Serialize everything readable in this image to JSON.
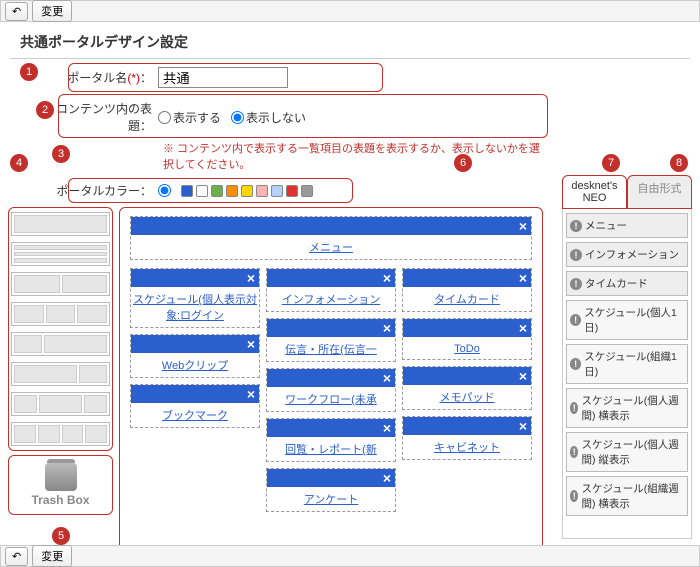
{
  "toolbar": {
    "back": "↶",
    "change": "変更"
  },
  "title": "共通ポータルデザイン設定",
  "form": {
    "name_label": "ポータル名",
    "req": "(*)",
    "colon": "：",
    "name_value": "共通",
    "content_title_label": "コンテンツ内の表題：",
    "radio_show": "表示する",
    "radio_hide": "表示しない",
    "note": "※ コンテンツ内で表示する一覧項目の表題を表示するか、表示しないかを選択してください。",
    "color_label": "ポータルカラー：",
    "colors": [
      "#2b5fce",
      "#ffffff",
      "#6ab04c",
      "#ff8c00",
      "#ffd700",
      "#ffb3b3",
      "#b3d1ff",
      "#d33",
      "#999999"
    ]
  },
  "badges": [
    "1",
    "2",
    "3",
    "4",
    "5",
    "6",
    "7",
    "8"
  ],
  "trash": "Trash Box",
  "canvas": {
    "top": "メニュー",
    "col1": [
      {
        "t": "スケジュール(個人表示対象:ログイン"
      },
      {
        "t": "Webクリップ"
      },
      {
        "t": "ブックマーク"
      }
    ],
    "col2": [
      {
        "t": "インフォメーション"
      },
      {
        "t": "伝言・所在(伝言一"
      },
      {
        "t": "ワークフロー(未承"
      },
      {
        "t": "回覧・レポート(新"
      },
      {
        "t": "アンケート"
      }
    ],
    "col3": [
      {
        "t": "タイムカード"
      },
      {
        "t": "ToDo"
      },
      {
        "t": "メモパッド"
      },
      {
        "t": "キャビネット"
      }
    ]
  },
  "tabs": {
    "a": "desknet's NEO",
    "b": "自由形式"
  },
  "side": [
    "メニュー",
    "インフォメーション",
    "タイムカード",
    "スケジュール(個人1日)",
    "スケジュール(組織1日)",
    "スケジュール(個人週間) 横表示",
    "スケジュール(個人週間) 縦表示",
    "スケジュール(組織週間) 横表示"
  ]
}
